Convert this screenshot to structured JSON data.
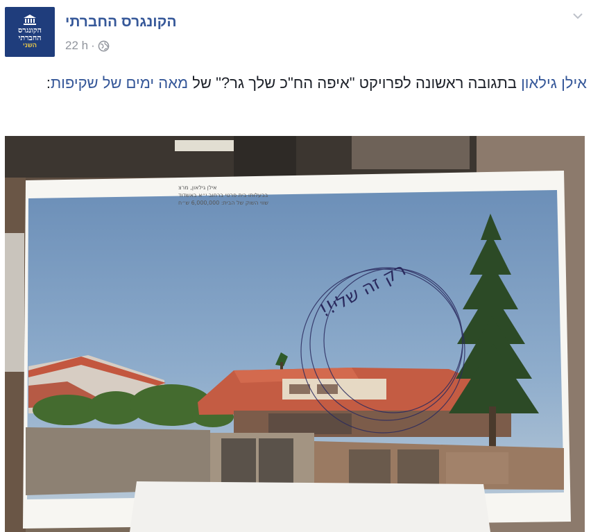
{
  "post": {
    "page_name": "הקונגרס החברתי",
    "avatar": {
      "line1": "הקונגרס",
      "line2": "החברתי",
      "line3": "השני"
    },
    "timestamp": "22 h",
    "separator": "·",
    "privacy_icon": "globe-icon",
    "options_icon": "chevron-down-icon",
    "text": {
      "author_link": "אילן גילאון",
      "middle": " בתגובה ראשונה לפרויקט \"איפה הח\"כ שלך גר?\" של ",
      "project_link": "מאה ימים של שקיפות",
      "end": ":"
    },
    "photo": {
      "caption_line1": "אילן גילאון, מרצ",
      "caption_line2": "בבעלותו בית פרטי ברחוב י״א באשדוד",
      "caption_line3": "שווי השוק של הבית: 6,000,000 ש״ח",
      "handwriting": "רק זה שלי!!"
    }
  },
  "colors": {
    "link": "#365899",
    "meta": "#90949c",
    "text": "#1d2129",
    "avatar_bg": "#1f3d7c",
    "avatar_accent": "#e8c84a"
  }
}
